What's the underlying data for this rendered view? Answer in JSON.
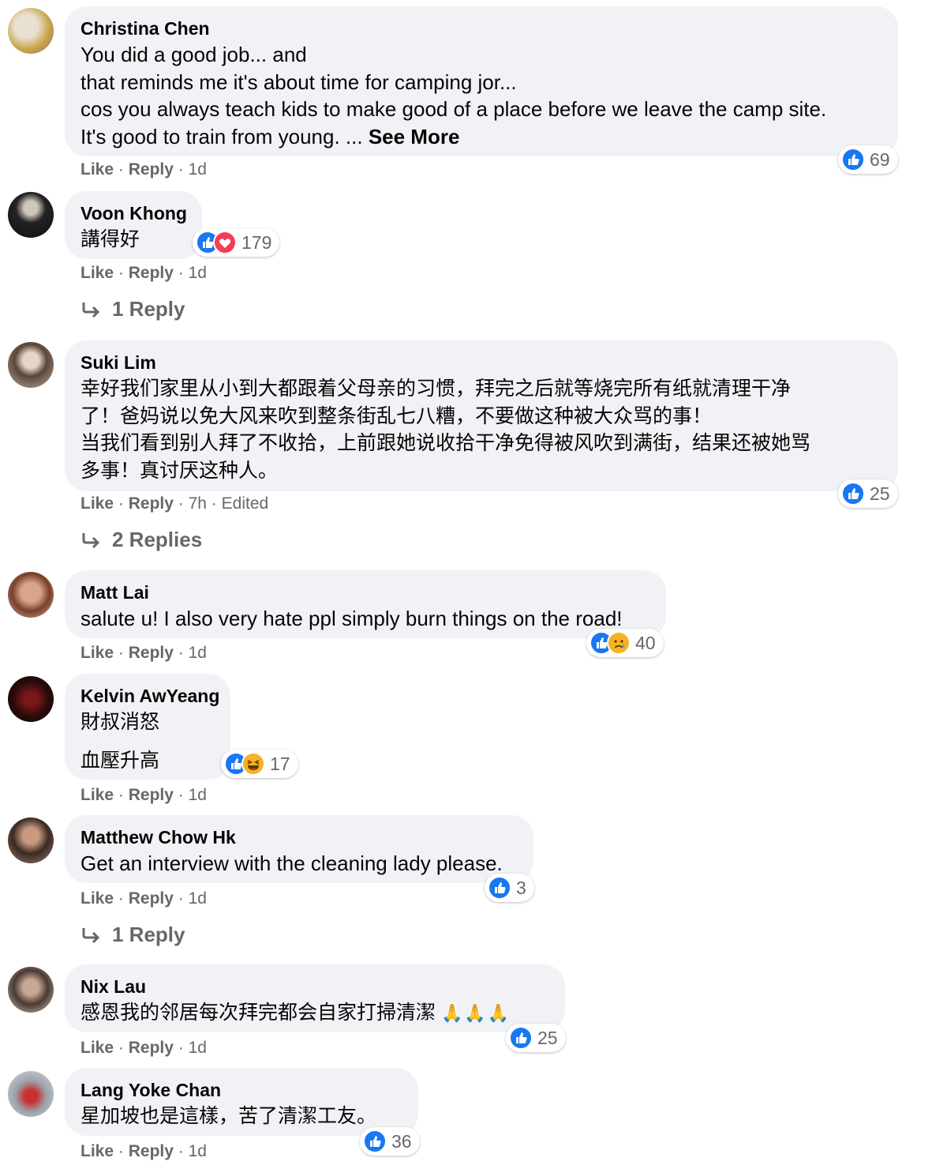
{
  "colors": {
    "bubble": "#f0f2f5",
    "like": "#1877f2",
    "love": "#f33e58",
    "meta": "#65676b",
    "haha": "#f7b125"
  },
  "actions": {
    "like": "Like",
    "reply": "Reply",
    "sep": "·"
  },
  "comments": [
    {
      "author": "Christina Chen",
      "lines": [
        "You did a good job... and",
        "that reminds me it's about time for camping jor...",
        "cos you always teach kids to make good of a place before we leave the camp site.",
        "It's good to train from young. ... "
      ],
      "see_more": "See More",
      "reactions": [
        "like"
      ],
      "reaction_count": "69",
      "time": "1d"
    },
    {
      "author": "Voon Khong",
      "lines": [
        "講得好"
      ],
      "reactions": [
        "like",
        "love"
      ],
      "reaction_count": "179",
      "time": "1d",
      "replies": "1 Reply"
    },
    {
      "author": "Suki Lim",
      "lines": [
        "幸好我们家里从小到大都跟着父母亲的习惯，拜完之后就等烧完所有纸就清理干净",
        "了！爸妈说以免大风来吹到整条街乱七八糟，不要做这种被大众骂的事！",
        "当我们看到别人拜了不收拾，上前跟她说收拾干净免得被风吹到满街，结果还被她骂",
        "多事！真讨厌这种人。"
      ],
      "reactions": [
        "like"
      ],
      "reaction_count": "25",
      "time": "7h",
      "edited": "Edited",
      "replies": "2 Replies"
    },
    {
      "author": "Matt Lai",
      "lines": [
        "salute u! I also very hate ppl simply burn things on the road!"
      ],
      "reactions": [
        "like",
        "sad"
      ],
      "reaction_count": "40",
      "time": "1d"
    },
    {
      "author": "Kelvin AwYeang",
      "lines": [
        "財叔消怒",
        "血壓升高"
      ],
      "reactions": [
        "like",
        "haha"
      ],
      "reaction_count": "17",
      "time": "1d"
    },
    {
      "author": "Matthew Chow Hk",
      "lines": [
        "Get an interview with the cleaning lady please."
      ],
      "reactions": [
        "like"
      ],
      "reaction_count": "3",
      "time": "1d",
      "replies": "1 Reply"
    },
    {
      "author": "Nix Lau",
      "lines": [
        "感恩我的邻居每次拜完都会自家打掃清潔"
      ],
      "emoji": "🙏🙏🙏",
      "reactions": [
        "like"
      ],
      "reaction_count": "25",
      "time": "1d"
    },
    {
      "author": "Lang Yoke Chan",
      "lines": [
        "星加坡也是這樣，苦了清潔工友。"
      ],
      "reactions": [
        "like"
      ],
      "reaction_count": "36",
      "time": "1d"
    }
  ]
}
